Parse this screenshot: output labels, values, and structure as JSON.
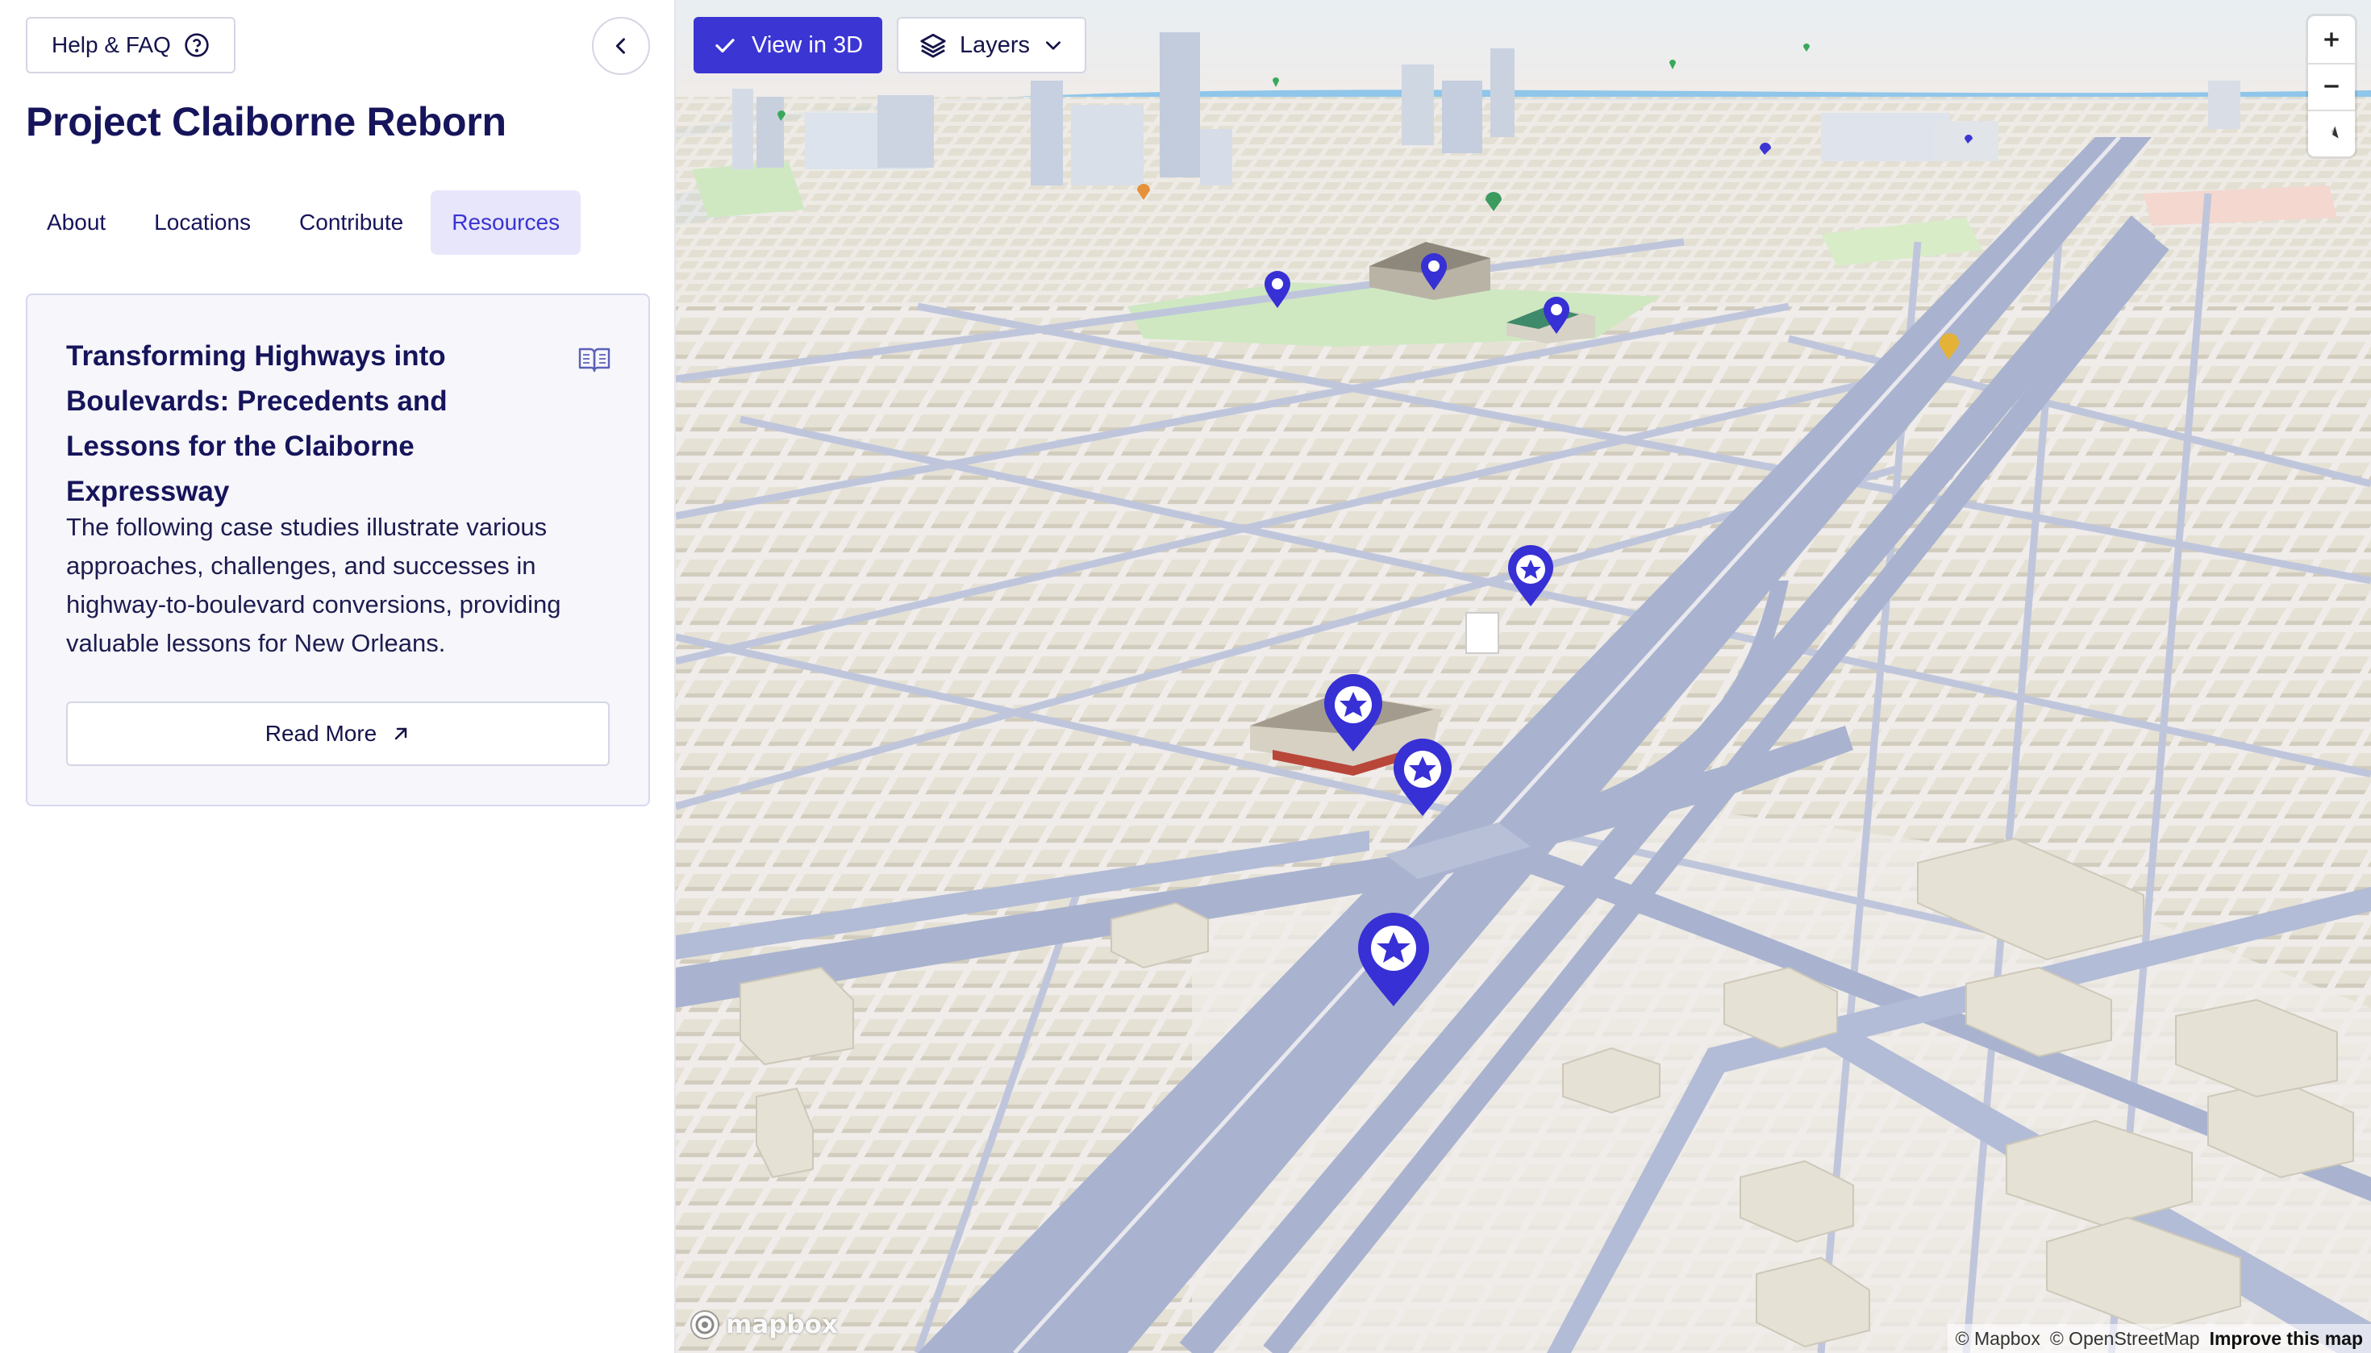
{
  "sidebar": {
    "help_label": "Help & FAQ",
    "title": "Project Claiborne Reborn",
    "tabs": [
      {
        "label": "About"
      },
      {
        "label": "Locations"
      },
      {
        "label": "Contribute"
      },
      {
        "label": "Resources",
        "active": true
      }
    ],
    "resource_card": {
      "title": "Transforming Highways into Boulevards: Precedents and Lessons for the Claiborne Expressway",
      "description": "The following case studies illustrate various approaches, challenges, and successes in highway-to-boulevard conversions, providing valuable lessons for New Orleans.",
      "button_label": "Read More",
      "icon": "book-open-icon"
    }
  },
  "map": {
    "view3d_label": "View in 3D",
    "layers_label": "Layers",
    "logo_text": "mapbox",
    "attribution": {
      "mapbox": "© Mapbox",
      "osm": "© OpenStreetMap",
      "improve": "Improve this map"
    },
    "colors": {
      "accent": "#3b35d4",
      "marker": "#3730d4",
      "road": "#a7b1ce",
      "building": "#e5e1d4",
      "ground": "#efecea",
      "park": "#cfe8c2",
      "water": "#8fc6ea"
    },
    "controls": [
      "zoom-in-icon",
      "zoom-out-icon",
      "compass-icon"
    ]
  }
}
